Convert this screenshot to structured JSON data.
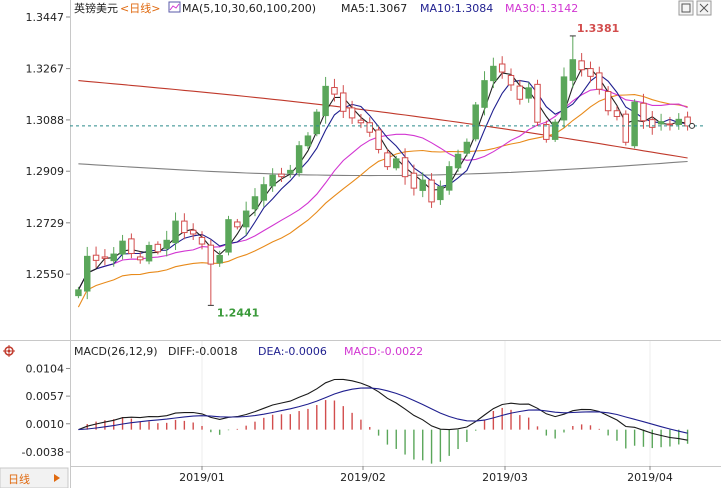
{
  "header": {
    "instrument": "英镑美元",
    "period_label": "<日线>",
    "ma_title": "MA(5,10,30,60,100,200)",
    "ma5_label": "MA5:1.3067",
    "ma10_label": "MA10:1.3084",
    "ma30_label": "MA30:1.3142"
  },
  "macd_header": {
    "title": "MACD(26,12,9)",
    "diff_label": "DIFF:-0.0018",
    "dea_label": "DEA:-0.0006",
    "macd_label": "MACD:-0.0022"
  },
  "period_tab": {
    "label": "日线"
  },
  "icons": {
    "window_button": "window-icon",
    "panel_settings": "gear-icon",
    "tab_arrow": "triangle-right-icon"
  },
  "colors": {
    "up": "#5aa65a",
    "down": "#d24d4d",
    "ma5": "#222222",
    "ma10": "#1f1f8f",
    "ma30": "#d236d2",
    "ma60": "#e88a1a",
    "ma100": "#808080",
    "ma200": "#c0392b",
    "diff": "#1a1a1a",
    "dea": "#1f1f8f",
    "macd_pos": "#d24d4d",
    "macd_neg": "#5aa65a",
    "last_price_line": "#2a8a8a"
  },
  "chart_data": [
    {
      "type": "candlestick",
      "title": "英镑美元<日线>",
      "y_ticks": [
        "1.3447",
        "1.3267",
        "1.3088",
        "1.2909",
        "1.2729",
        "1.2550"
      ],
      "ylim": [
        1.2383,
        1.3447
      ],
      "x_ticks": [
        "2019/01",
        "2019/02",
        "2019/03",
        "2019/04"
      ],
      "annotations": {
        "high": {
          "label": "1.3381",
          "value": 1.3381
        },
        "low": {
          "label": "1.2441",
          "value": 1.2441
        }
      },
      "last_price": 1.3067,
      "close": [
        1.2495,
        1.2612,
        1.2598,
        1.2605,
        1.262,
        1.2665,
        1.2622,
        1.26,
        1.265,
        1.2628,
        1.2668,
        1.2735,
        1.2695,
        1.269,
        1.2655,
        1.2585,
        1.2615,
        1.274,
        1.2715,
        1.277,
        1.282,
        1.2862,
        1.2895,
        1.289,
        1.2912,
        1.2998,
        1.3032,
        1.3115,
        1.3205,
        1.3178,
        1.3118,
        1.3095,
        1.3078,
        1.3045,
        1.2985,
        1.2925,
        1.2952,
        1.289,
        1.285,
        1.2878,
        1.2802,
        1.2855,
        1.2925,
        1.2968,
        1.301,
        1.314,
        1.3225,
        1.3275,
        1.3255,
        1.321,
        1.316,
        1.32,
        1.308,
        1.302,
        1.308,
        1.3238,
        1.3298,
        1.3263,
        1.324,
        1.3195,
        1.312,
        1.31,
        1.301,
        1.315,
        1.3085,
        1.3062,
        1.3082,
        1.3072,
        1.309,
        1.3067
      ],
      "series": [
        {
          "name": "MA5",
          "value": 1.3067
        },
        {
          "name": "MA10",
          "value": 1.3084
        },
        {
          "name": "MA30",
          "value": 1.3142
        }
      ]
    },
    {
      "type": "macd",
      "title": "MACD(26,12,9)",
      "y_ticks": [
        "0.0104",
        "0.0057",
        "0.0010",
        "-0.0038"
      ],
      "ylim": [
        -0.0055,
        0.0115
      ],
      "diff_last": -0.0018,
      "dea_last": -0.0006,
      "macd_last": -0.0022
    }
  ]
}
